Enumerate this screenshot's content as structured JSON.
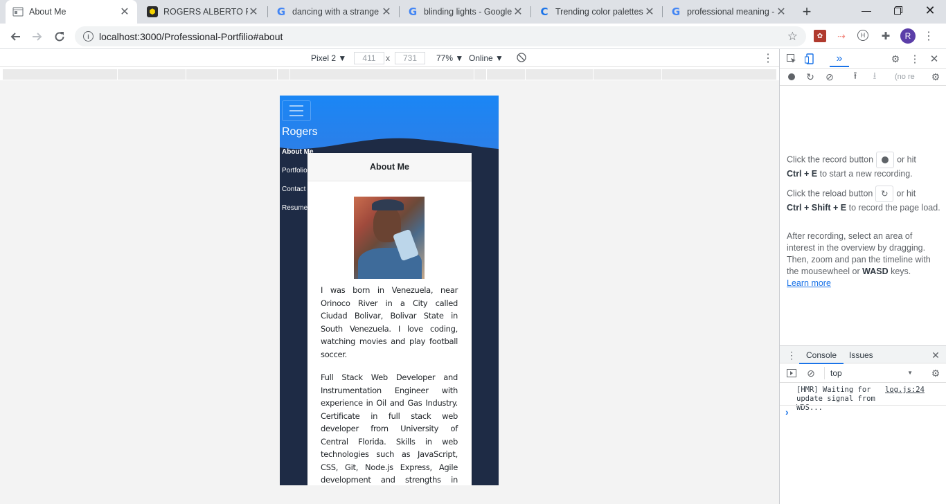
{
  "tabs": [
    {
      "title": "About Me",
      "icon": "page-icon",
      "active": true
    },
    {
      "title": "ROGERS ALBERTO RAM",
      "icon": "hex-logo-icon"
    },
    {
      "title": "dancing with a strange",
      "icon": "google-icon"
    },
    {
      "title": "blinding lights - Google",
      "icon": "google-icon"
    },
    {
      "title": "Trending color palettes",
      "icon": "coolors-icon"
    },
    {
      "title": "professional meaning -",
      "icon": "google-icon"
    }
  ],
  "address_bar": {
    "url": "localhost:3000/Professional-Portfilio#about"
  },
  "device_toolbar": {
    "device": "Pixel 2 ▼",
    "width": "411",
    "x": "x",
    "height": "731",
    "zoom": "77% ▼",
    "network": "Online ▼"
  },
  "site": {
    "brand": "Rogers",
    "nav": [
      "About Me",
      "Portfolio",
      "Contact",
      "Resume"
    ],
    "card_title": "About Me",
    "para1": "I was born in Venezuela, near Orinoco River in a City called Ciudad Bolivar, Bolivar State in South Venezuela. I love coding, watching movies and play football soccer.",
    "para2": "Full Stack Web Developer and Instrumentation Engineer with experience in Oil and Gas Industry. Certificate in full stack web developer from University of Central Florida. Skills in web technologies such as JavaScript, CSS, Git, Node.js Express, Agile development and strengths in working under pressure,"
  },
  "devtools": {
    "no_recording": "(no re",
    "rec1_a": "Click the record button",
    "rec1_b": "or hit",
    "rec1_keys": "Ctrl + E",
    "rec1_c": "to start a new recording.",
    "rel_a": "Click the reload button",
    "rel_b": "or hit",
    "rel_keys": "Ctrl + Shift + E",
    "rel_c": "to record the page load.",
    "after": "After recording, select an area of interest in the overview by dragging. Then, zoom and pan the timeline with the mousewheel or",
    "after_key": "WASD",
    "after_end": "keys.",
    "learn_more": "Learn more",
    "console_tab": "Console",
    "issues_tab": "Issues",
    "context": "top",
    "msg": "[HMR] Waiting for update signal from WDS...",
    "msg_src": "log.js:24",
    "prompt": "›"
  },
  "colors": {
    "accent": "#1a73e8",
    "header_blue": "#1a86f5",
    "device_bg": "#1e2b45"
  }
}
